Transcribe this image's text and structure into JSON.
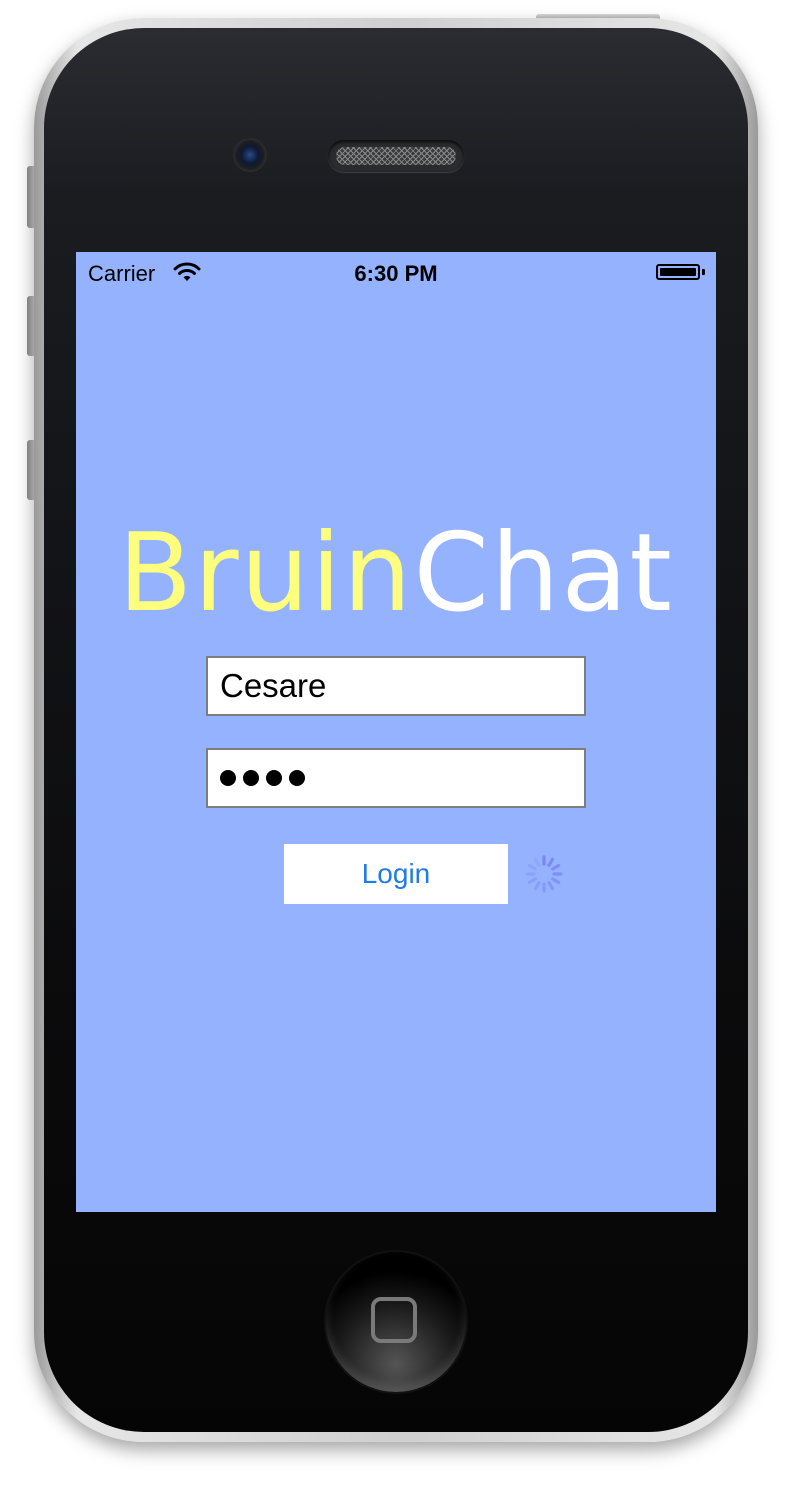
{
  "status_bar": {
    "carrier": "Carrier",
    "time": "6:30 PM"
  },
  "logo": {
    "part1": "Bruin",
    "part2": "Chat"
  },
  "form": {
    "username_value": "Cesare",
    "password_mask": "••••",
    "login_label": "Login"
  },
  "icons": [
    "wifi-icon",
    "battery-icon",
    "activity-spinner-icon",
    "home-button-icon"
  ],
  "colors": {
    "screen_background": "#95b2ff",
    "logo_bruin": "#fdfd7e",
    "logo_chat": "#ffffff",
    "login_text": "#1f7be8",
    "spinner": "#7a86f5"
  }
}
